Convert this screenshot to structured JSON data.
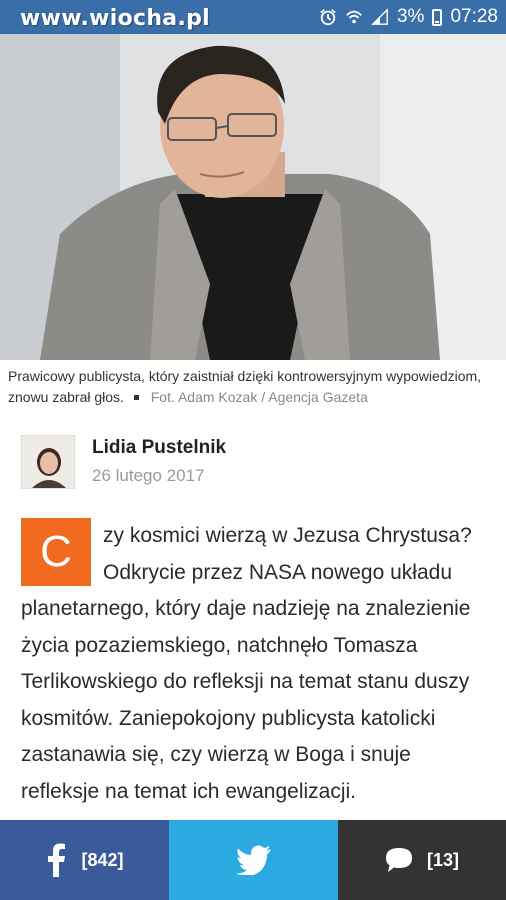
{
  "status_bar": {
    "watermark": "www.wiocha.pl",
    "battery": "3%",
    "time": "07:28",
    "icons": [
      "alarm-icon",
      "wifi-icon",
      "signal-icon",
      "battery-icon"
    ]
  },
  "photo": {
    "caption": "Prawicowy publicysta, który zaistniał dzięki kontrowersyjnym wypowiedziom, znowu zabrał głos.",
    "credit": "Fot. Adam Kozak / Agencja Gazeta"
  },
  "author": {
    "name": "Lidia Pustelnik",
    "date": "26 lutego 2017"
  },
  "article": {
    "dropcap": "C",
    "body": "zy kosmici wierzą w Jezusa Chrystusa? Odkrycie przez NASA nowego układu planetarnego, który daje nadzieję na znalezienie życia pozaziemskiego, natchnęło Tomasza Terlikowskiego do refleksji na temat stanu duszy kosmitów. Zaniepokojony publicysta katolicki zastanawia się, czy wierzą w Boga i snuje refleksje na temat ich ewangelizacji."
  },
  "share_bar": {
    "facebook_count": "[842]",
    "comments_count": "[13]",
    "colors": {
      "facebook": "#3b5a99",
      "twitter": "#2ba9e1",
      "comments": "#333333",
      "accent": "#f26a1f"
    }
  }
}
